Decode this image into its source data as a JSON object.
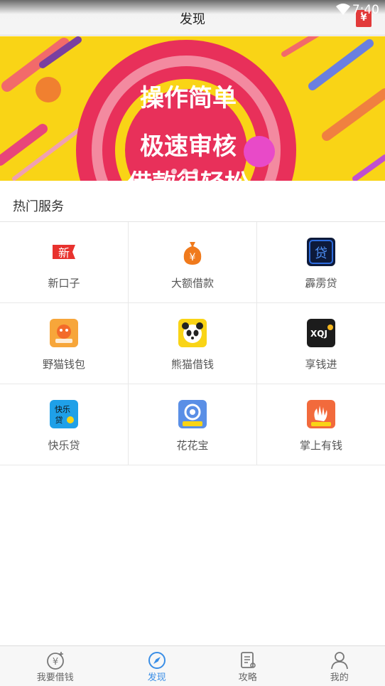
{
  "status": {
    "time": "7:40"
  },
  "header": {
    "title": "发现",
    "action_icon": "yen-envelope-icon",
    "action_glyph": "¥"
  },
  "banner": {
    "line1": "操作简单",
    "line2": "极速审核",
    "line3": "借款很轻松",
    "dots": 3
  },
  "section": {
    "title": "热门服务"
  },
  "services": [
    {
      "label": "新口子",
      "icon": "new-tag-icon",
      "glyph": "新"
    },
    {
      "label": "大额借款",
      "icon": "money-bag-icon",
      "glyph": "¥"
    },
    {
      "label": "霹雳贷",
      "icon": "pili-dai-icon",
      "glyph": "贷"
    },
    {
      "label": "野猫钱包",
      "icon": "wildcat-icon",
      "glyph": ""
    },
    {
      "label": "熊猫借钱",
      "icon": "panda-icon",
      "glyph": ""
    },
    {
      "label": "享钱进",
      "icon": "xqj-icon",
      "glyph": "XQJ"
    },
    {
      "label": "快乐贷",
      "icon": "kuaile-dai-icon",
      "glyph": "快乐贷"
    },
    {
      "label": "花花宝",
      "icon": "huahua-bao-icon",
      "glyph": ""
    },
    {
      "label": "掌上有钱",
      "icon": "palm-money-icon",
      "glyph": ""
    }
  ],
  "tabbar": {
    "items": [
      {
        "label": "我要借钱",
        "icon": "yen-coin-icon"
      },
      {
        "label": "发现",
        "icon": "compass-icon"
      },
      {
        "label": "攻略",
        "icon": "document-icon"
      },
      {
        "label": "我的",
        "icon": "user-icon"
      }
    ],
    "active": 1,
    "active_color": "#3a8ee6"
  }
}
